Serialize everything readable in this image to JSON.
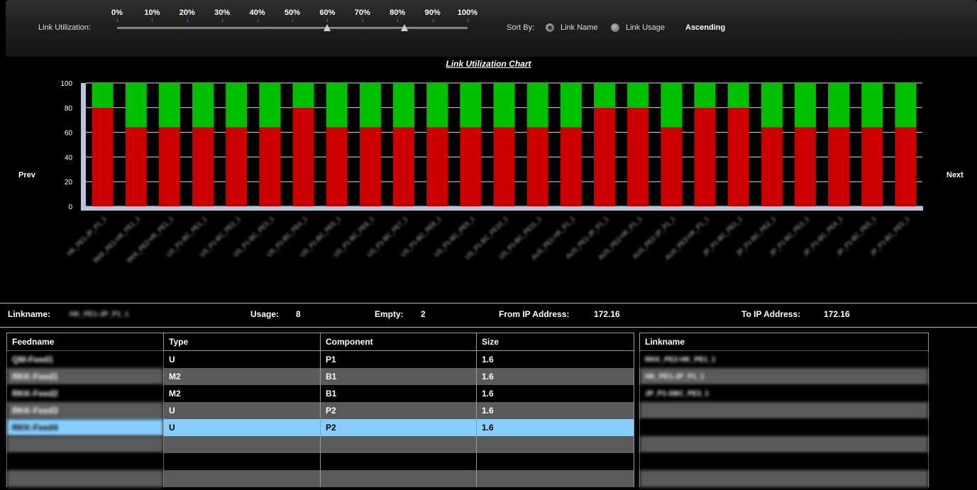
{
  "toolbar": {
    "utilization_label": "Link Utilization:",
    "ticks": [
      "0%",
      "10%",
      "20%",
      "30%",
      "40%",
      "50%",
      "60%",
      "70%",
      "80%",
      "90%",
      "100%"
    ],
    "slider_low_pct": 60,
    "slider_high_pct": 82,
    "sort_by_label": "Sort By:",
    "sort_options": [
      "Link Name",
      "Link Usage"
    ],
    "sort_selected": "Link Name",
    "order_label": "Ascending"
  },
  "chart_data": {
    "type": "bar",
    "title": "Link Utilization Chart",
    "ylim": [
      0,
      100
    ],
    "yticks": [
      0,
      20,
      40,
      60,
      80,
      100
    ],
    "stacked": true,
    "grid": true,
    "colors": {
      "used": "#cc0000",
      "empty": "#00c000"
    },
    "categories": [
      "HK_PE1-JP_P1_1",
      "RKK_PE1-HK_PE1_1",
      "RKK_PE2-HK_PE1_1",
      "US_P1-BC_PE1_1",
      "US_P1-BC_PE2_1",
      "US_P1-BC_PE3_1",
      "US_P1-BC_PE4_1",
      "US_P1-BC_PE5_1",
      "US_P1-BC_PE6_1",
      "US_P1-BC_PE7_1",
      "US_P1-BC_PE8_1",
      "US_P1-BC_PE9_1",
      "US_P1-BC_PE10_1",
      "US_P1-BC_PE11_1",
      "AUS_PE1-HK_P1_1",
      "AUS_PE1-JP_P1_1",
      "AUS_PE2-HK_P1_1",
      "AUS_PE2-JP_P1_1",
      "AUS_PE3-HK_P1_1",
      "JP_P1-BC_PE1_1",
      "JP_P1-BC_PE2_1",
      "JP_P1-BC_PE3_1",
      "JP_P1-BC_PE4_1",
      "JP_P1-BC_PE5_1"
    ],
    "series": [
      {
        "values": [
          80,
          64,
          64,
          64,
          64,
          64,
          80,
          64,
          64,
          64,
          64,
          64,
          64,
          64,
          64,
          80,
          80,
          64,
          80,
          80,
          64,
          64,
          64,
          64,
          64
        ]
      },
      {
        "values": [
          20,
          36,
          36,
          36,
          36,
          36,
          20,
          36,
          36,
          36,
          36,
          36,
          36,
          36,
          36,
          20,
          20,
          36,
          20,
          20,
          36,
          36,
          36,
          36,
          36
        ]
      }
    ]
  },
  "nav": {
    "prev": "Prev",
    "next": "Next"
  },
  "info": {
    "linkname_label": "Linkname:",
    "linkname_value": "HK_PE1-JP_P1_1",
    "usage_label": "Usage:",
    "usage_value": "8",
    "empty_label": "Empty:",
    "empty_value": "2",
    "from_ip_label": "From IP Address:",
    "from_ip_value": "172.16",
    "to_ip_label": "To IP Address:",
    "to_ip_value": "172.16"
  },
  "feed_table": {
    "headers": [
      "Feedname",
      "Type",
      "Component",
      "Size"
    ],
    "rows": [
      [
        "QM-Feed1",
        "U",
        "P1",
        "1.6"
      ],
      [
        "RKK-Feed1",
        "M2",
        "B1",
        "1.6"
      ],
      [
        "RKK-Feed2",
        "M2",
        "B1",
        "1.6"
      ],
      [
        "RKK-Feed3",
        "U",
        "P2",
        "1.6"
      ],
      [
        "RKK-Feed4",
        "U",
        "P2",
        "1.6"
      ],
      [
        "",
        "",
        "",
        ""
      ],
      [
        "",
        "",
        "",
        ""
      ],
      [
        "",
        "",
        "",
        ""
      ]
    ],
    "selected_row": 4
  },
  "link_table": {
    "header": "Linkname",
    "rows": [
      "RKK_PE2-HK_PE1_1",
      "HK_PE1-JP_P1_1",
      "JP_P1-SBC_PE3_1",
      "",
      "",
      "",
      "",
      ""
    ]
  }
}
